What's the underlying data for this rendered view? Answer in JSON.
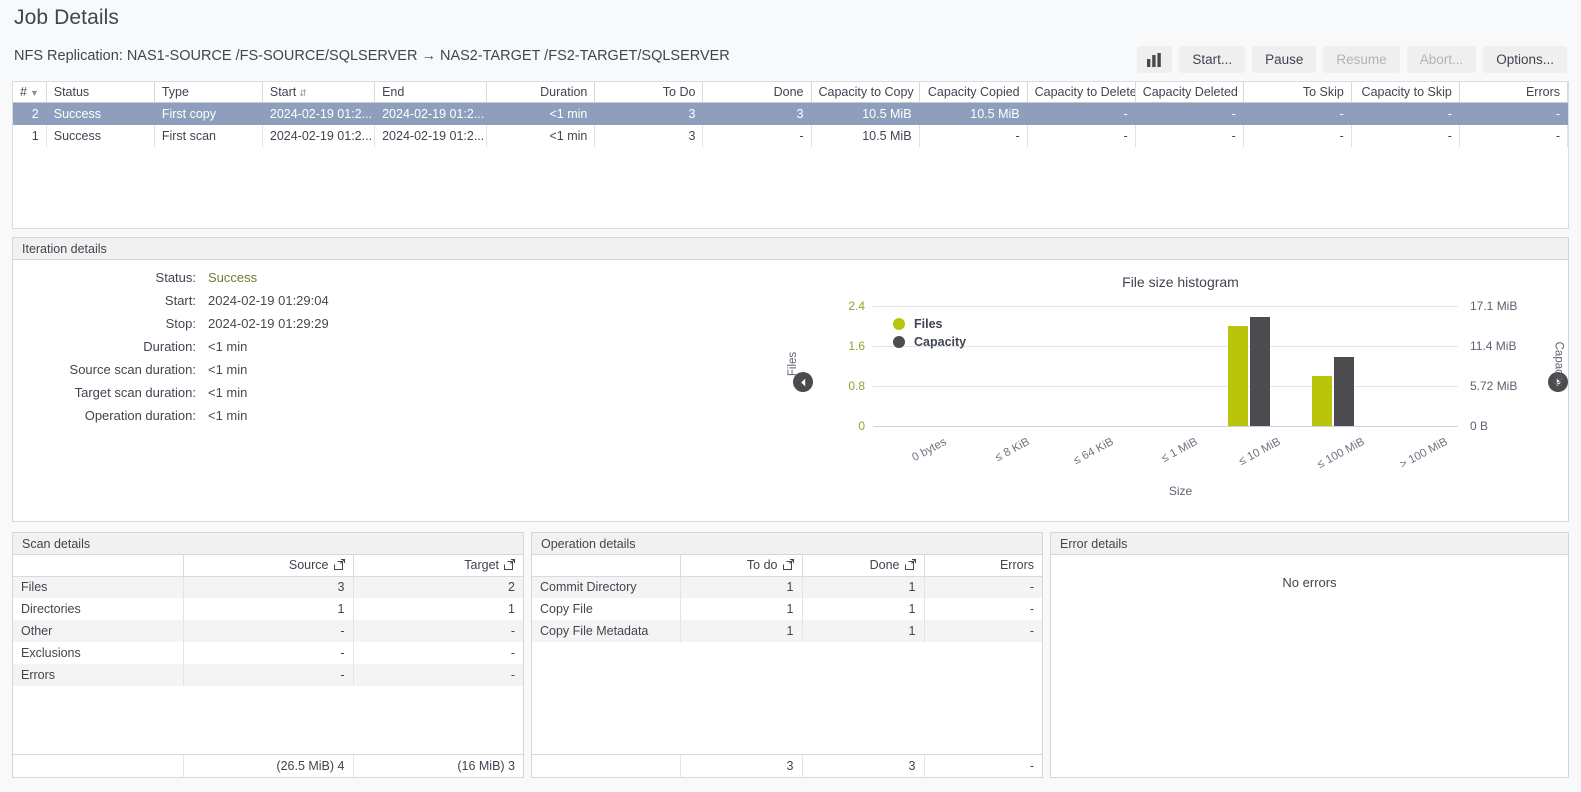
{
  "header": {
    "title": "Job Details",
    "subtitle": "NFS Replication: NAS1-SOURCE /FS-SOURCE/SQLSERVER → NAS2-TARGET /FS2-TARGET/SQLSERVER"
  },
  "toolbar": {
    "chart_icon": "bar-chart-icon",
    "buttons": [
      {
        "label": "Start...",
        "disabled": false
      },
      {
        "label": "Pause",
        "disabled": false
      },
      {
        "label": "Resume",
        "disabled": true
      },
      {
        "label": "Abort...",
        "disabled": true
      },
      {
        "label": "Options...",
        "disabled": false
      }
    ]
  },
  "iterations_grid": {
    "columns": [
      "#",
      "Status",
      "Type",
      "Start",
      "End",
      "Duration",
      "To Do",
      "Done",
      "Capacity to Copy",
      "Capacity Copied",
      "Capacity to Delete",
      "Capacity Deleted",
      "To Skip",
      "Capacity to Skip",
      "Errors"
    ],
    "rows": [
      {
        "selected": true,
        "cells": [
          "2",
          "Success",
          "First copy",
          "2024-02-19 01:2...",
          "2024-02-19 01:2...",
          "<1 min",
          "3",
          "3",
          "10.5 MiB",
          "10.5 MiB",
          "-",
          "-",
          "-",
          "-",
          "-"
        ]
      },
      {
        "selected": false,
        "cells": [
          "1",
          "Success",
          "First scan",
          "2024-02-19 01:2...",
          "2024-02-19 01:2...",
          "<1 min",
          "3",
          "-",
          "10.5 MiB",
          "-",
          "-",
          "-",
          "-",
          "-",
          "-"
        ]
      }
    ]
  },
  "iteration_details": {
    "panel_title": "Iteration details",
    "fields": [
      {
        "label": "Status:",
        "value": "Success",
        "status": true
      },
      {
        "label": "Start:",
        "value": "2024-02-19 01:29:04",
        "status": false
      },
      {
        "label": "Stop:",
        "value": "2024-02-19 01:29:29",
        "status": false
      },
      {
        "label": "Duration:",
        "value": "<1 min",
        "status": false
      },
      {
        "label": "Source scan duration:",
        "value": "<1 min",
        "status": false
      },
      {
        "label": "Target scan duration:",
        "value": "<1 min",
        "status": false
      },
      {
        "label": "Operation duration:",
        "value": "<1 min",
        "status": false
      }
    ]
  },
  "chart_data": {
    "type": "bar",
    "title": "File size histogram",
    "xlabel": "Size",
    "ylabel": "Files",
    "y2label": "Capacity",
    "categories": [
      "0 bytes",
      "≤ 8 KiB",
      "≤ 64 KiB",
      "≤ 1 MiB",
      "≤ 10 MiB",
      "≤ 100 MiB",
      "> 100 MiB"
    ],
    "series": [
      {
        "name": "Files",
        "color": "#b9c50b",
        "values": [
          0,
          0,
          0,
          0,
          2,
          1,
          0
        ]
      },
      {
        "name": "Capacity",
        "color": "#4c4c50",
        "values": [
          0,
          0,
          0,
          0,
          15.5,
          9.8,
          0
        ]
      }
    ],
    "ylim": [
      0,
      2.4
    ],
    "yticks": [
      0,
      0.8,
      1.6,
      2.4
    ],
    "ytick_labels": [
      "0",
      "0.8",
      "1.6",
      "2.4"
    ],
    "y2lim": [
      0,
      17.1
    ],
    "y2ticks": [
      0,
      5.72,
      11.4,
      17.1
    ],
    "y2tick_labels": [
      "0 B",
      "5.72 MiB",
      "11.4 MiB",
      "17.1 MiB"
    ],
    "grid": true,
    "legend_position": "inside-top-left",
    "nav_prev": "previous-chart-arrow",
    "nav_next": "next-chart-arrow"
  },
  "scan_details": {
    "panel_title": "Scan details",
    "columns": [
      "",
      "Source",
      "Target"
    ],
    "rows": [
      {
        "label": "Files",
        "source": "3",
        "target": "2"
      },
      {
        "label": "Directories",
        "source": "1",
        "target": "1"
      },
      {
        "label": "Other",
        "source": "-",
        "target": "-"
      },
      {
        "label": "Exclusions",
        "source": "-",
        "target": "-"
      },
      {
        "label": "Errors",
        "source": "-",
        "target": "-"
      }
    ],
    "footer": {
      "label": "",
      "source": "(26.5 MiB) 4",
      "target": "(16 MiB) 3"
    }
  },
  "operation_details": {
    "panel_title": "Operation details",
    "columns": [
      "",
      "To do",
      "Done",
      "Errors"
    ],
    "rows": [
      {
        "label": "Commit Directory",
        "todo": "1",
        "done": "1",
        "errors": "-"
      },
      {
        "label": "Copy File",
        "todo": "1",
        "done": "1",
        "errors": "-"
      },
      {
        "label": "Copy File Metadata",
        "todo": "1",
        "done": "1",
        "errors": "-"
      }
    ],
    "footer": {
      "label": "",
      "todo": "3",
      "done": "3",
      "errors": "-"
    }
  },
  "error_details": {
    "panel_title": "Error details",
    "empty_message": "No errors"
  }
}
